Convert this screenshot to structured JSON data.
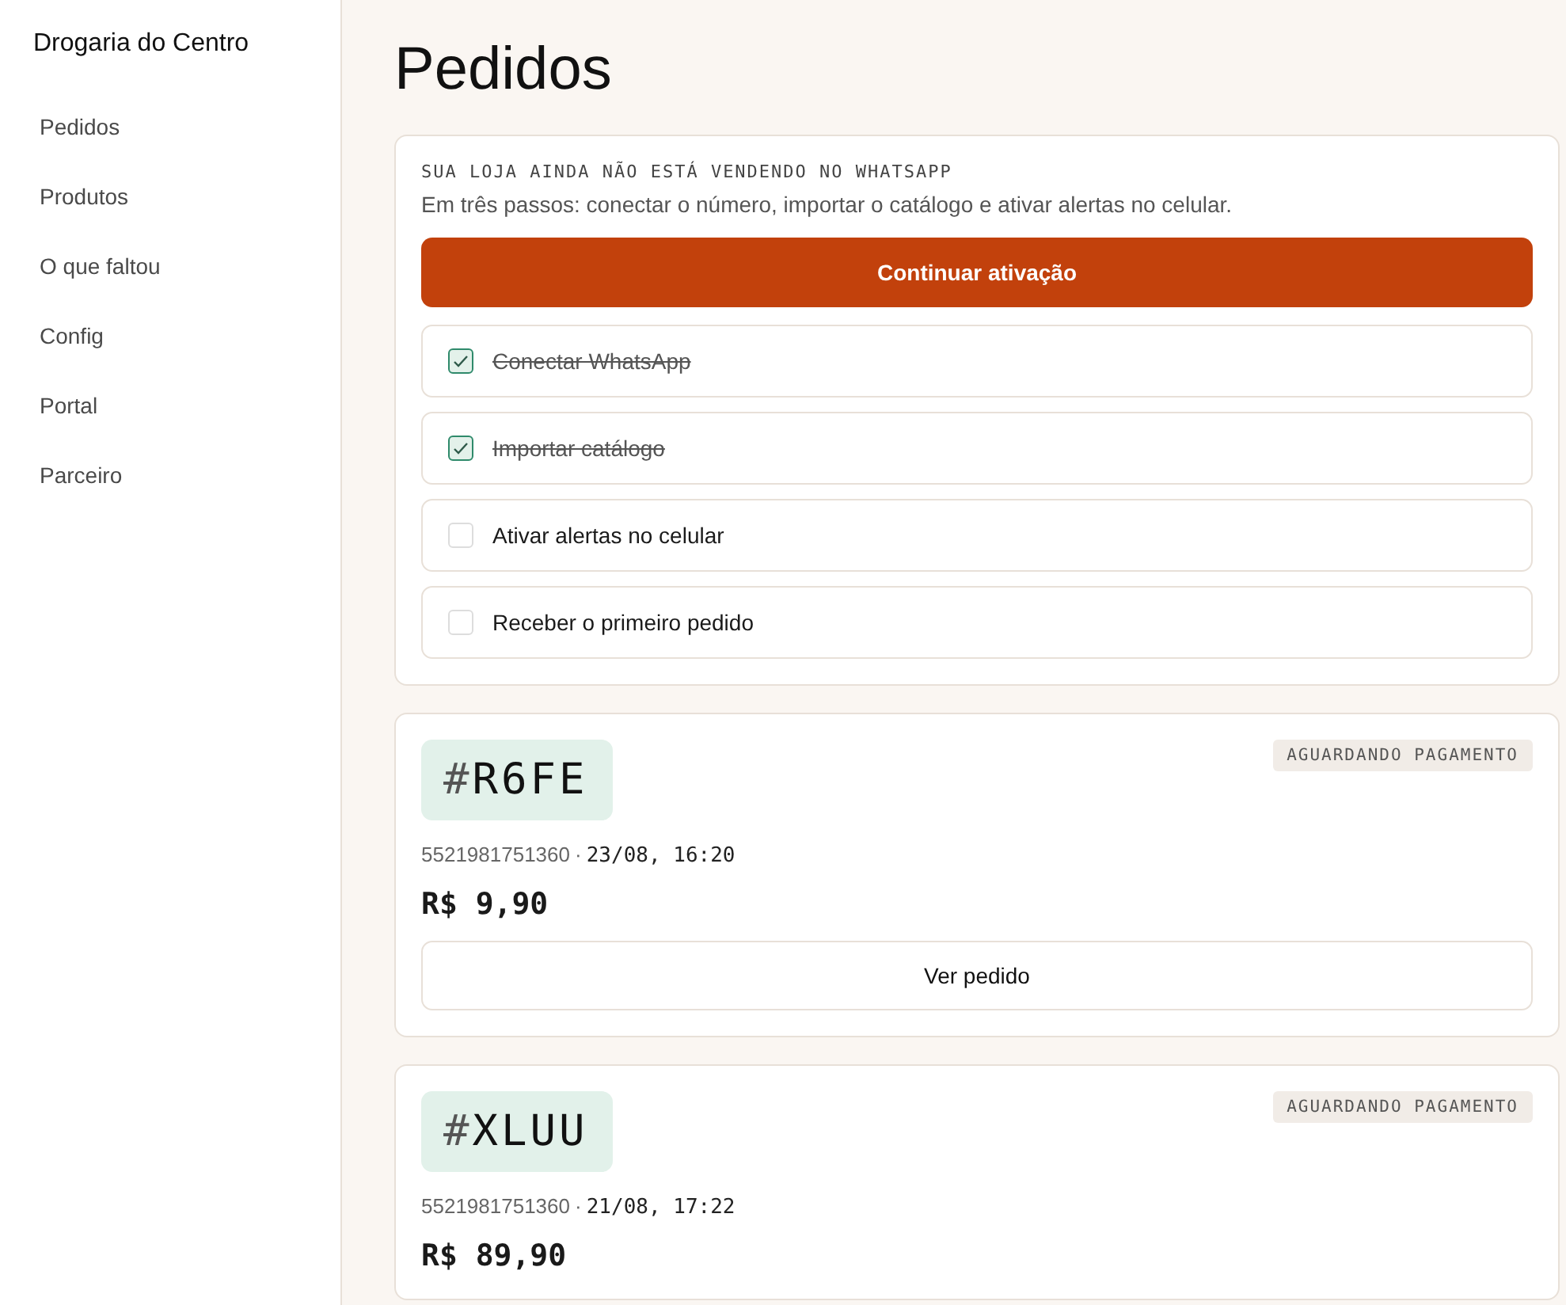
{
  "sidebar": {
    "store_name": "Drogaria do Centro",
    "items": [
      {
        "label": "Pedidos"
      },
      {
        "label": "Produtos"
      },
      {
        "label": "O que faltou"
      },
      {
        "label": "Config"
      },
      {
        "label": "Portal"
      },
      {
        "label": "Parceiro"
      }
    ]
  },
  "page_title": "Pedidos",
  "setup": {
    "eyebrow": "SUA LOJA AINDA NÃO ESTÁ VENDENDO NO WHATSAPP",
    "description": "Em três passos: conectar o número, importar o catálogo e ativar alertas no celular.",
    "button": "Continuar ativação",
    "steps": [
      {
        "label": "Conectar WhatsApp",
        "checked": true
      },
      {
        "label": "Importar catálogo",
        "checked": true
      },
      {
        "label": "Ativar alertas no celular",
        "checked": false
      },
      {
        "label": "Receber o primeiro pedido",
        "checked": false
      }
    ]
  },
  "orders": [
    {
      "id_prefix": "#",
      "id": "R6FE",
      "status": "AGUARDANDO PAGAMENTO",
      "phone": "5521981751360",
      "separator": "·",
      "date": "23/08, 16:20",
      "total": "R$ 9,90",
      "button": "Ver pedido"
    },
    {
      "id_prefix": "#",
      "id": "XLUU",
      "status": "AGUARDANDO PAGAMENTO",
      "phone": "5521981751360",
      "separator": "·",
      "date": "21/08, 17:22",
      "total": "R$ 89,90"
    }
  ]
}
